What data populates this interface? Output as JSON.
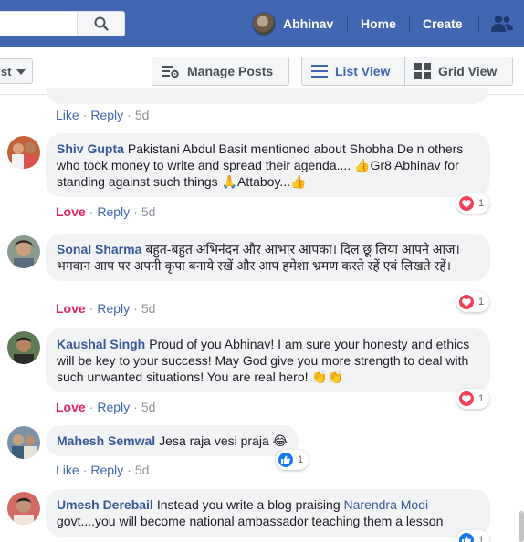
{
  "nav": {
    "search_placeholder": "",
    "user_name": "Abhinav",
    "home_label": "Home",
    "create_label": "Create",
    "icons": [
      "search-icon",
      "friends-icon"
    ],
    "brand_color": "#4267b2"
  },
  "toolbar": {
    "sort_label": "st",
    "manage_posts_label": "Manage Posts",
    "list_view_label": "List View",
    "grid_view_label": "Grid View",
    "icons": [
      "manage-posts-icon",
      "list-view-icon",
      "grid-view-icon"
    ]
  },
  "previous_comment": {
    "actions": {
      "like": "Like",
      "reply": "Reply",
      "time": "5d"
    }
  },
  "comments": [
    {
      "author": "Shiv Gupta",
      "text": "Pakistani Abdul Basit mentioned about Shobha De n others who took money to write and spread their agenda.... 👍Gr8 Abhinav for standing against such things 🙏Attaboy...👍",
      "actions": {
        "react": "Love",
        "reply": "Reply",
        "time": "5d"
      },
      "reaction": {
        "type": "love",
        "count": "1"
      }
    },
    {
      "author": "Sonal Sharma",
      "text": "बहुत-बहुत अभिनंदन और आभार आपका। दिल छू लिया आपने आज। भगवान आप पर अपनी कृपा बनाये रखें और आप हमेशा भ्रमण करते रहें एवं लिखते रहें।",
      "actions": {
        "react": "Love",
        "reply": "Reply",
        "time": "5d"
      },
      "reaction": {
        "type": "love",
        "count": "1"
      }
    },
    {
      "author": "Kaushal Singh",
      "text": "Proud of you Abhinav! I am sure your honesty and ethics will be key to your success! May God give you more strength to deal with such unwanted situations! You are real hero! 👏👏",
      "actions": {
        "react": "Love",
        "reply": "Reply",
        "time": "5d"
      },
      "reaction": {
        "type": "love",
        "count": "1"
      }
    },
    {
      "author": "Mahesh Semwal",
      "text": "Jesa raja vesi praja 😂",
      "actions": {
        "react": "Like",
        "reply": "Reply",
        "time": "5d"
      },
      "reaction": {
        "type": "like",
        "count": "1"
      }
    },
    {
      "author": "Umesh Derebail",
      "text_before": "Instead you write a blog praising",
      "mention": "Narendra Modi",
      "text_after": "govt....you will become national ambassador teaching them a lesson",
      "reaction": {
        "type": "like",
        "count": "1"
      }
    }
  ]
}
